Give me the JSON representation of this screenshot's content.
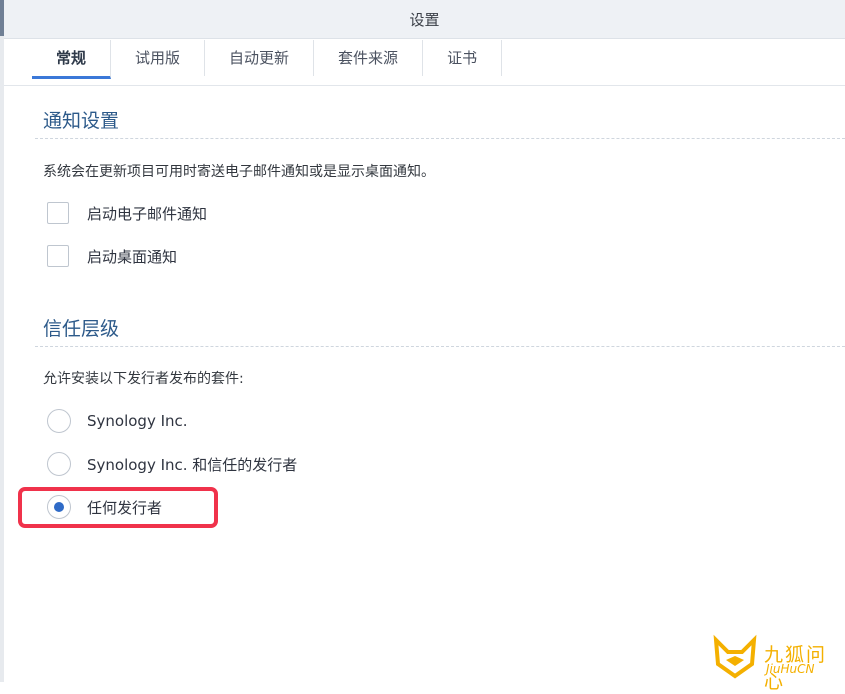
{
  "window": {
    "title": "设置"
  },
  "tabs": [
    {
      "label": "常规",
      "active": true
    },
    {
      "label": "试用版",
      "active": false
    },
    {
      "label": "自动更新",
      "active": false
    },
    {
      "label": "套件来源",
      "active": false
    },
    {
      "label": "证书",
      "active": false
    }
  ],
  "notification": {
    "title": "通知设置",
    "description": "系统会在更新项目可用时寄送电子邮件通知或是显示桌面通知。",
    "options": [
      {
        "label": "启动电子邮件通知",
        "checked": false
      },
      {
        "label": "启动桌面通知",
        "checked": false
      }
    ]
  },
  "trust": {
    "title": "信任层级",
    "description": "允许安装以下发行者发布的套件:",
    "options": [
      {
        "label": "Synology Inc.",
        "selected": false
      },
      {
        "label": "Synology Inc. 和信任的发行者",
        "selected": false
      },
      {
        "label": "任何发行者",
        "selected": true
      }
    ]
  },
  "watermark": {
    "name": "九狐问心",
    "sub": "JiuHuCN"
  },
  "colors": {
    "accent": "#3b78d8",
    "section_title": "#2d5a8a",
    "highlight": "#f0324b",
    "watermark": "#f4b000"
  }
}
